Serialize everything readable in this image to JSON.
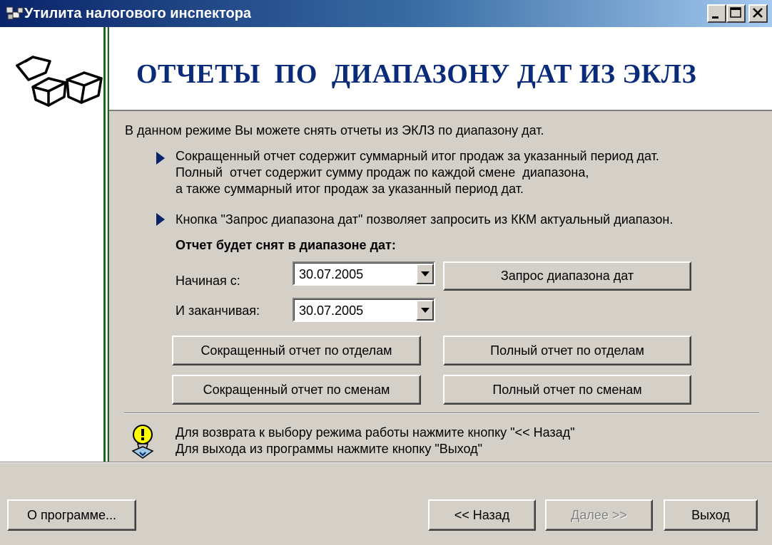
{
  "window": {
    "title": "Утилита налогового инспектора"
  },
  "header": {
    "title": "ОТЧЕТЫ  ПО  ДИАПАЗОНУ ДАТ ИЗ ЭКЛЗ"
  },
  "content": {
    "intro": "В данном режиме Вы можете снять отчеты из ЭКЛЗ по диапазону дат.",
    "bullet1": "Сокращенный отчет содержит суммарный итог продаж за указанный период дат.\nПолный  отчет содержит сумму продаж по каждой смене  диапазона,\nа также суммарный итог продаж за указанный период дат.",
    "bullet2": "Кнопка \"Запрос диапазона дат\" позволяет запросить из ККМ актуальный диапазон.",
    "range_heading": "Отчет будет снят в диапазоне дат:",
    "start_label": "Начиная с:",
    "start_value": "30.07.2005",
    "end_label": "И заканчивая:",
    "end_value": "30.07.2005",
    "request_range_button": "Запрос диапазона дат",
    "short_by_department_button": "Сокращенный отчет по отделам",
    "full_by_department_button": "Полный отчет по отделам",
    "short_by_shift_button": "Сокращенный отчет по сменам",
    "full_by_shift_button": "Полный отчет по сменам",
    "hint": "Для возврата к выбору режима работы нажмите кнопку \"<< Назад\"\nДля выхода из программы нажмите кнопку \"Выход\""
  },
  "footer": {
    "about_button": "О программе...",
    "back_button": "<< Назад",
    "next_button": "Далее >>",
    "exit_button": "Выход"
  },
  "icons": {
    "app": "cubes-icon",
    "bullet": "triangle-right-icon",
    "hint": "lightbulb-icon"
  },
  "colors": {
    "title_gradient_start": "#0a246a",
    "header_title": "#0a2a7a",
    "accent_line": "#1c6b1c"
  }
}
